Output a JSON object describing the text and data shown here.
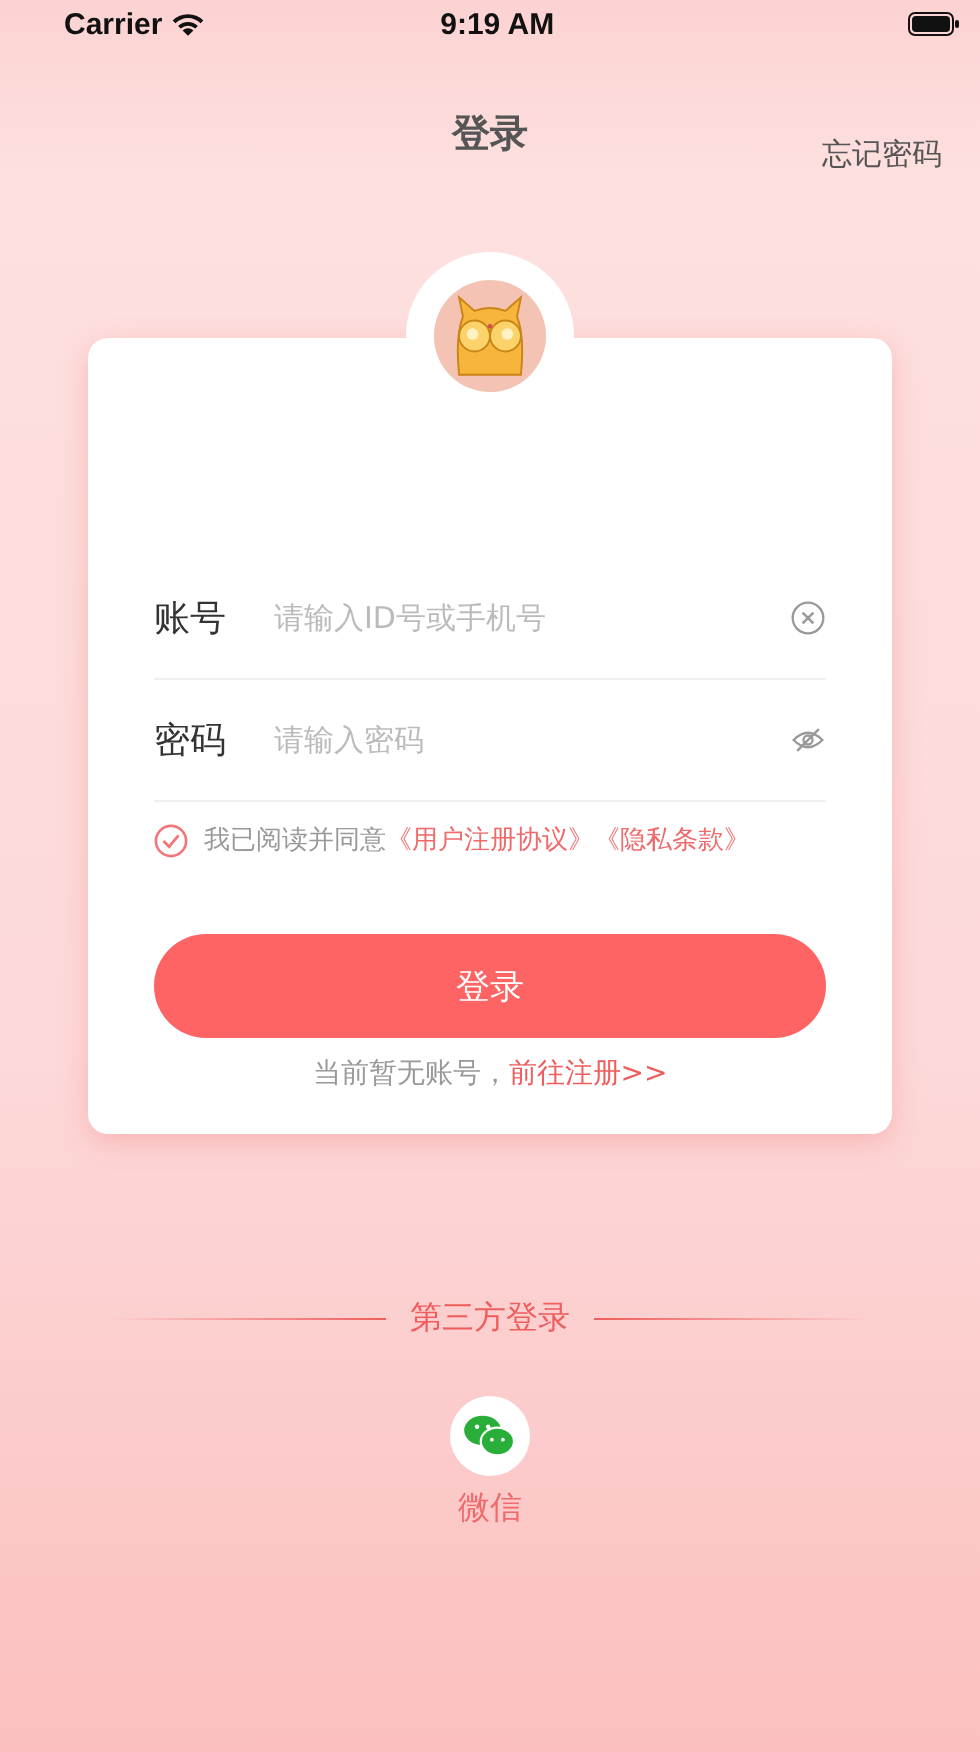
{
  "status_bar": {
    "carrier": "Carrier",
    "time": "9:19 AM"
  },
  "header": {
    "title": "登录",
    "forgot_password": "忘记密码"
  },
  "form": {
    "fields": [
      {
        "label": "账号",
        "placeholder": "请输入ID号或手机号",
        "kind": "clear"
      },
      {
        "label": "密码",
        "placeholder": "请输入密码",
        "kind": "eye"
      }
    ],
    "agreement": {
      "checked": true,
      "text": "我已阅读并同意",
      "links": [
        "《用户注册协议》",
        "《隐私条款》"
      ]
    },
    "login_button": "登录",
    "register": {
      "text": "当前暂无账号，",
      "link": "前往注册>>"
    }
  },
  "third_party": {
    "title": "第三方登录",
    "options": [
      {
        "label": "微信"
      }
    ]
  }
}
